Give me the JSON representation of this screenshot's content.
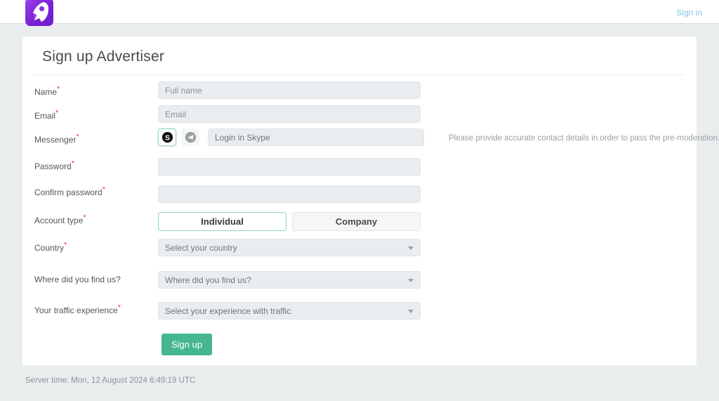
{
  "header": {
    "logo_icon": "rocket-logo-icon",
    "signin_label": "Sign in"
  },
  "card": {
    "title": "Sign up Advertiser"
  },
  "form": {
    "required_marker": "*",
    "rows": {
      "name": {
        "label": "Name",
        "required": true,
        "placeholder": "Full name",
        "value": ""
      },
      "email": {
        "label": "Email",
        "required": true,
        "placeholder": "Email",
        "value": ""
      },
      "messenger": {
        "label": "Messenger",
        "required": true,
        "placeholder": "Login in Skype",
        "value": "",
        "options": [
          {
            "name": "skype-icon",
            "label": "Skype",
            "selected": true
          },
          {
            "name": "telegram-icon",
            "label": "Telegram",
            "selected": false
          }
        ],
        "hint": "Please provide accurate contact details in order to pass the pre-moderation."
      },
      "password": {
        "label": "Password",
        "required": true,
        "placeholder": "",
        "value": ""
      },
      "confirm_password": {
        "label": "Confirm password",
        "required": true,
        "placeholder": "",
        "value": ""
      },
      "account_type": {
        "label": "Account type",
        "required": true,
        "options": [
          {
            "label": "Individual",
            "selected": true
          },
          {
            "label": "Company",
            "selected": false
          }
        ]
      },
      "country": {
        "label": "Country",
        "required": true,
        "selected": "Select your country"
      },
      "find_us": {
        "label": "Where did you find us?",
        "required": false,
        "selected": "Where did you find us?"
      },
      "traffic_experience": {
        "label": "Your traffic experience",
        "required": true,
        "selected": "Select your experience with traffic"
      }
    },
    "submit_label": "Sign up"
  },
  "footer": {
    "server_time": "Server time: Mon, 12 August 2024 6:49:19 UTC"
  },
  "colors": {
    "page_background": "#e9edee",
    "card_background": "#ffffff",
    "accent_green": "#45b68e",
    "selected_border_green": "#8fd5ba",
    "required_red": "#e8443a",
    "link_blue": "#7fc4e8",
    "input_background": "#e9edf0",
    "logo_purple": "#7b22d8"
  }
}
